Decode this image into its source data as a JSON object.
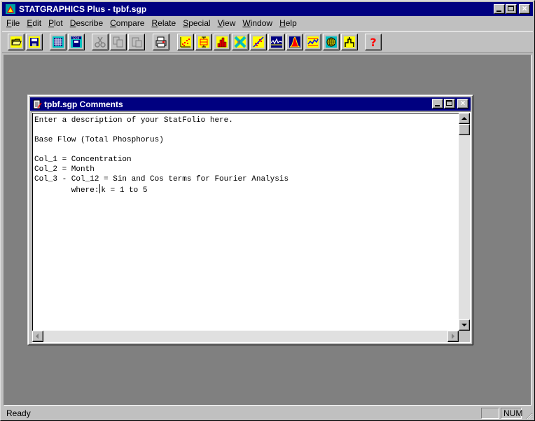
{
  "app": {
    "title": "STATGRAPHICS Plus - tpbf.sgp"
  },
  "menu": [
    {
      "pre": "",
      "key": "F",
      "post": "ile"
    },
    {
      "pre": "",
      "key": "E",
      "post": "dit"
    },
    {
      "pre": "",
      "key": "P",
      "post": "lot"
    },
    {
      "pre": "",
      "key": "D",
      "post": "escribe"
    },
    {
      "pre": "",
      "key": "C",
      "post": "ompare"
    },
    {
      "pre": "",
      "key": "R",
      "post": "elate"
    },
    {
      "pre": "",
      "key": "S",
      "post": "pecial"
    },
    {
      "pre": "",
      "key": "V",
      "post": "iew"
    },
    {
      "pre": "",
      "key": "W",
      "post": "indow"
    },
    {
      "pre": "",
      "key": "H",
      "post": "elp"
    }
  ],
  "toolbar": {
    "icons": [
      "open-folder-icon",
      "save-disk-icon",
      "spreadsheet-icon",
      "save-data-icon",
      "cut-icon",
      "copy-icon",
      "paste-icon",
      "print-icon",
      "scatterplot-icon",
      "boxplot-icon",
      "histogram-icon",
      "distribution-icon",
      "regression-icon",
      "timeseries-icon",
      "normal-curve-icon",
      "quality-control-icon",
      "globe-icon",
      "tree-icon",
      "help-icon"
    ],
    "help_glyph": "?"
  },
  "child": {
    "title": "tpbf.sgp Comments",
    "lines": [
      "Enter a description of your StatFolio here.",
      "",
      "Base Flow (Total Phosphorus)",
      "",
      "Col_1 = Concentration",
      "Col_2 = Month",
      "Col_3 - Col_12 = Sin and Cos terms for Fourier Analysis"
    ],
    "last_line_before_caret": "        where:",
    "last_line_after_caret": "k = 1 to 5"
  },
  "status": {
    "text": "Ready",
    "num": "NUM"
  },
  "colors": {
    "titlebar": "#000080",
    "face": "#c0c0c0",
    "workspace": "#808080"
  }
}
